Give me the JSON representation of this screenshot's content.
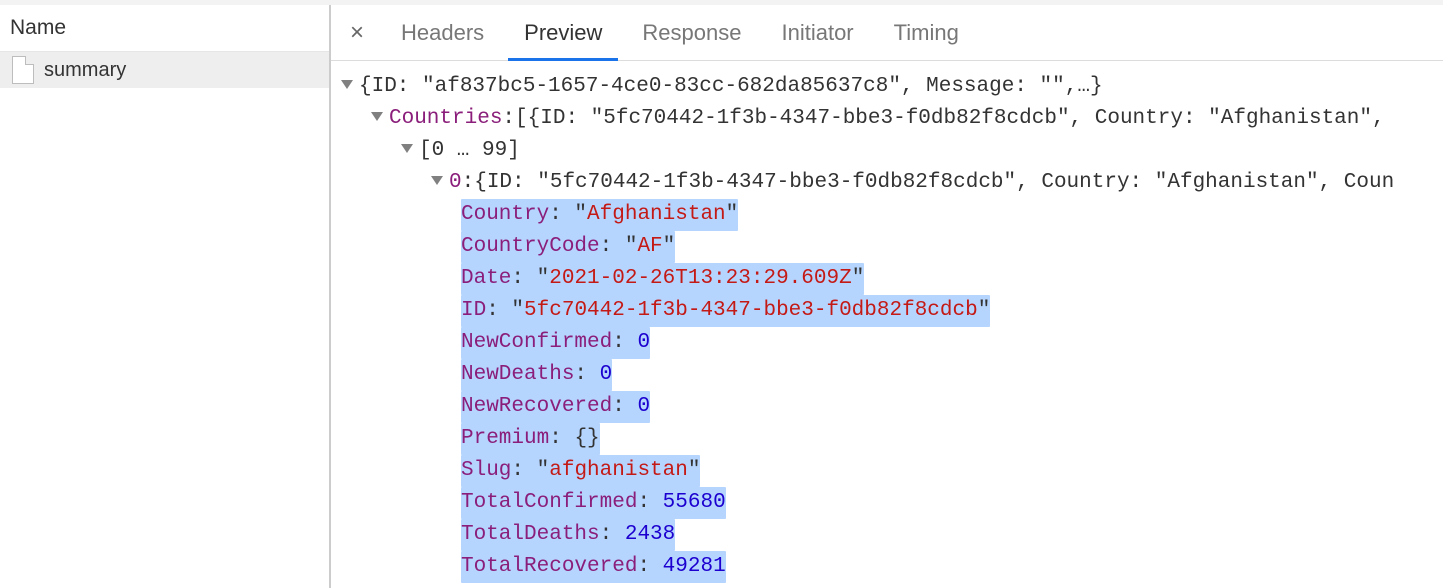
{
  "left": {
    "header": "Name",
    "items": [
      "summary"
    ]
  },
  "tabs": {
    "close": "×",
    "list": [
      "Headers",
      "Preview",
      "Response",
      "Initiator",
      "Timing"
    ],
    "active": "Preview"
  },
  "preview": {
    "root": {
      "ID": "af837bc5-1657-4ce0-83cc-682da85637c8",
      "Message": ""
    },
    "countriesPreview": {
      "ID": "5fc70442-1f3b-4347-bbe3-f0db82f8cdcb",
      "Country": "Afghanistan"
    },
    "range": "[0 … 99]",
    "index0Preview": {
      "ID": "5fc70442-1f3b-4347-bbe3-f0db82f8cdcb",
      "Country": "Afghanistan",
      "CountryTruncated": "Coun"
    },
    "item0": {
      "Country": "Afghanistan",
      "CountryCode": "AF",
      "Date": "2021-02-26T13:23:29.609Z",
      "ID": "5fc70442-1f3b-4347-bbe3-f0db82f8cdcb",
      "NewConfirmed": 0,
      "NewDeaths": 0,
      "NewRecovered": 0,
      "Premium": "{}",
      "Slug": "afghanistan",
      "TotalConfirmed": 55680,
      "TotalDeaths": 2438,
      "TotalRecovered": 49281
    },
    "labels": {
      "Countries": "Countries",
      "Country": "Country",
      "CountryCode": "CountryCode",
      "Date": "Date",
      "ID": "ID",
      "NewConfirmed": "NewConfirmed",
      "NewDeaths": "NewDeaths",
      "NewRecovered": "NewRecovered",
      "Premium": "Premium",
      "Slug": "Slug",
      "TotalConfirmed": "TotalConfirmed",
      "TotalDeaths": "TotalDeaths",
      "TotalRecovered": "TotalRecovered"
    }
  }
}
